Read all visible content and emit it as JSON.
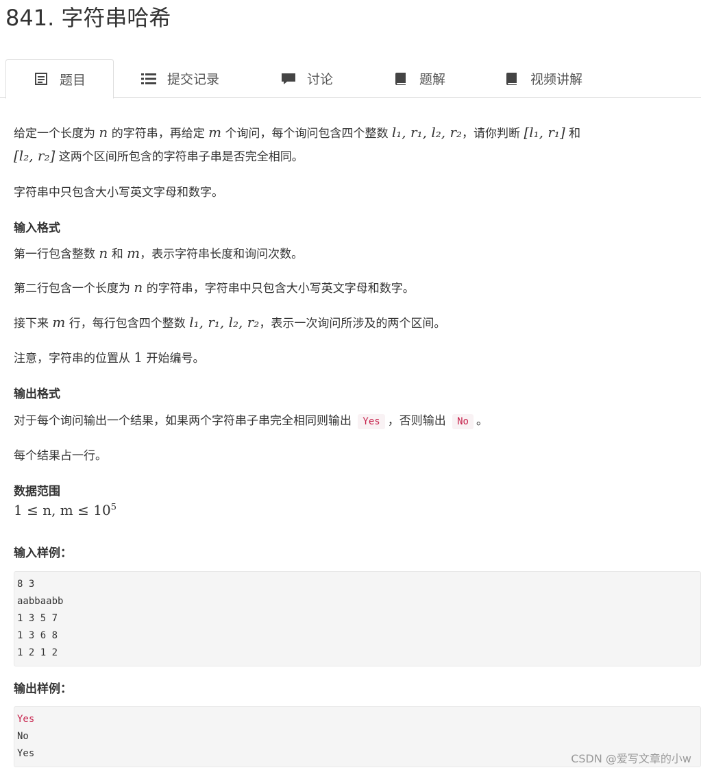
{
  "problem": {
    "title": "841. 字符串哈希"
  },
  "tabs": [
    {
      "label": "题目",
      "icon": "list-icon",
      "active": true
    },
    {
      "label": "提交记录",
      "icon": "menu-list-icon",
      "active": false
    },
    {
      "label": "讨论",
      "icon": "comment-icon",
      "active": false
    },
    {
      "label": "题解",
      "icon": "book-icon",
      "active": false
    },
    {
      "label": "视频讲解",
      "icon": "book-icon",
      "active": false
    }
  ],
  "desc": {
    "p1a": "给定一个长度为",
    "n": "n",
    "p1b": "的字符串，再给定",
    "m": "m",
    "p1c": "个询问，每个询问包含四个整数",
    "vars": "l₁, r₁, l₂, r₂",
    "p1d": "，请你判断",
    "range1": "[l₁, r₁]",
    "p1e": "和",
    "range2": "[l₂, r₂]",
    "p1f": "这两个区间所包含的字符串子串是否完全相同。",
    "p2": "字符串中只包含大小写英文字母和数字。"
  },
  "input_format": {
    "heading": "输入格式",
    "l1a": "第一行包含整数",
    "l1b": "和",
    "l1c": "，表示字符串长度和询问次数。",
    "l2a": "第二行包含一个长度为",
    "l2b": "的字符串，字符串中只包含大小写英文字母和数字。",
    "l3a": "接下来",
    "l3b": "行，每行包含四个整数",
    "l3c": "，表示一次询问所涉及的两个区间。",
    "l4a": "注意，字符串的位置从",
    "one": "1",
    "l4b": "开始编号。"
  },
  "output_format": {
    "heading": "输出格式",
    "l1a": "对于每个询问输出一个结果，如果两个字符串子串完全相同则输出",
    "yes": "Yes",
    "l1b": "，否则输出",
    "no": "No",
    "l1c": "。",
    "l2": "每个结果占一行。"
  },
  "range": {
    "heading": "数据范围",
    "expr_left": "1 ≤ n, m ≤ 10",
    "exp": "5"
  },
  "sample_input": {
    "heading": "输入样例：",
    "lines": [
      "8 3",
      "aabbaabb",
      "1 3 5 7",
      "1 3 6 8",
      "1 2 1 2"
    ]
  },
  "sample_output": {
    "heading": "输出样例：",
    "lines": [
      "Yes",
      "No",
      "Yes"
    ]
  },
  "watermark": "CSDN @爱写文章的小w"
}
